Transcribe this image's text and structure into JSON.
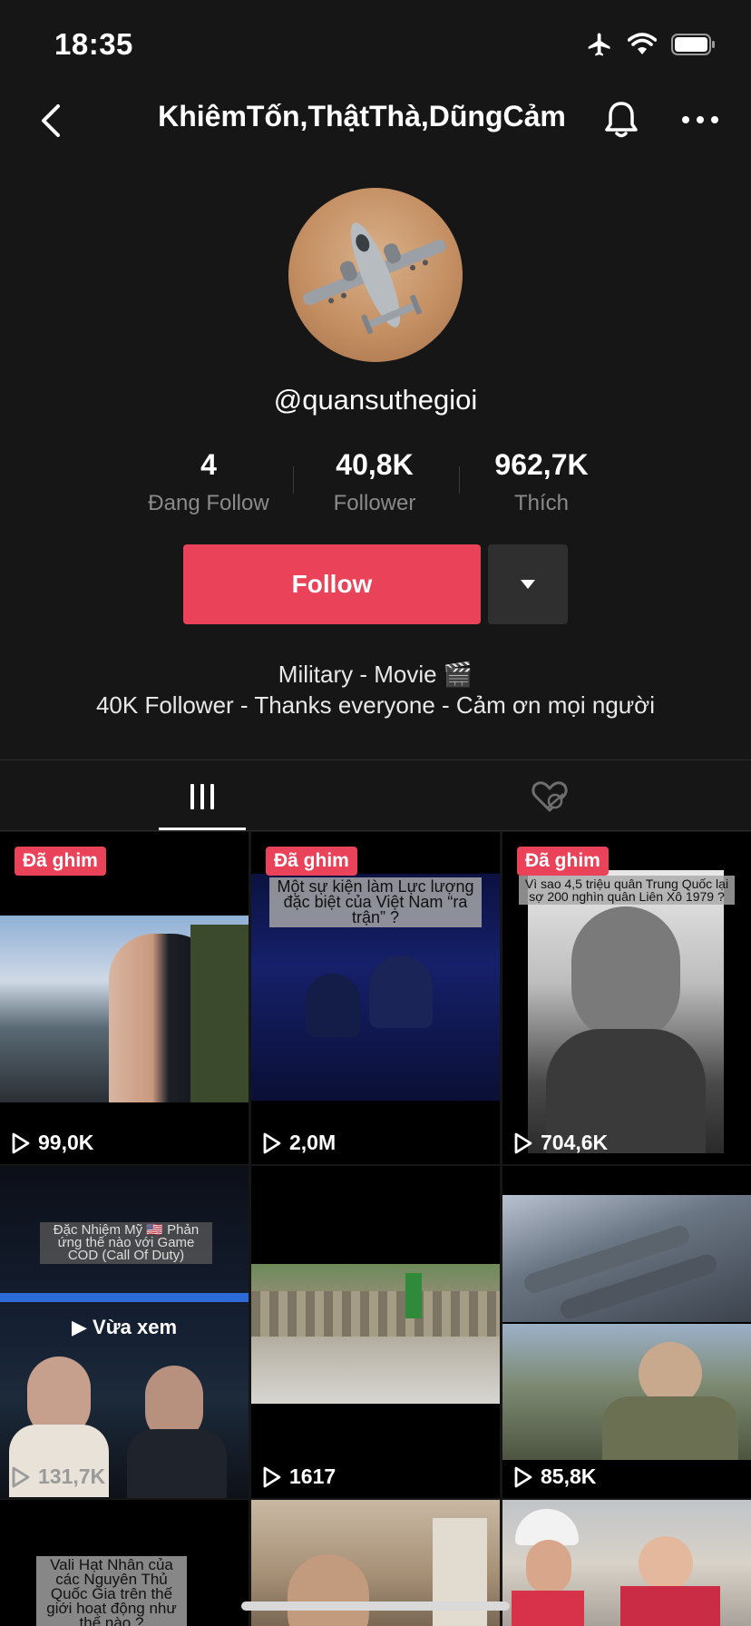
{
  "status_bar": {
    "time": "18:35",
    "icons": [
      "airplane-icon",
      "wifi-icon",
      "battery-icon"
    ]
  },
  "header": {
    "title": "KhiêmTốn,ThậtThà,DũngCảm"
  },
  "profile": {
    "username": "@quansuthegioi",
    "stats": [
      {
        "value": "4",
        "label": "Đang Follow"
      },
      {
        "value": "40,8K",
        "label": "Follower"
      },
      {
        "value": "962,7K",
        "label": "Thích"
      }
    ],
    "follow_label": "Follow",
    "bio_line1": "Military - Movie 🎬",
    "bio_line2": "40K Follower - Thanks everyone - Cảm ơn mọi người"
  },
  "tabs": [
    {
      "name": "videos",
      "icon": "grid-icon",
      "active": true
    },
    {
      "name": "liked",
      "icon": "hidden-heart-icon",
      "active": false
    }
  ],
  "videos": [
    {
      "pinned": "Đã ghim",
      "views": "99,0K"
    },
    {
      "pinned": "Đã ghim",
      "views": "2,0M",
      "caption": "Một sự kiện làm Lực lượng đặc biệt của Việt Nam “ra trận” ?"
    },
    {
      "pinned": "Đã ghim",
      "views": "704,6K",
      "caption": "Vì sao 4,5 triệu quân Trung Quốc lại sợ 200 nghìn quân Liên Xô 1979 ?"
    },
    {
      "views": "131,7K",
      "caption": "Đặc Nhiệm Mỹ 🇺🇸 Phản ứng thế nào với Game COD (Call Of Duty)",
      "watched": "Vừa xem"
    },
    {
      "views": "1617"
    },
    {
      "views": "85,8K"
    },
    {
      "caption": "Vali Hạt Nhân của các Nguyên Thủ Quốc Gia trên thế giới hoạt động như thế nào ?"
    },
    {},
    {}
  ],
  "colors": {
    "accent": "#ea4359",
    "background": "#161616",
    "muted": "#8a8a8a"
  }
}
